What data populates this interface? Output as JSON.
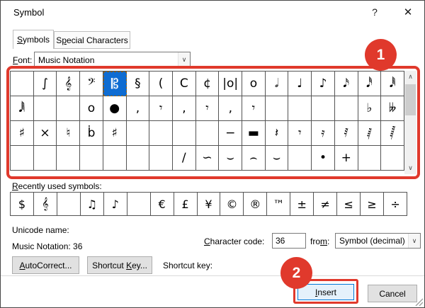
{
  "window": {
    "title": "Symbol",
    "help_glyph": "?",
    "close_glyph": "✕"
  },
  "tabs": [
    {
      "label": "Symbols",
      "active": true
    },
    {
      "label": "Special Characters",
      "active": false
    }
  ],
  "font_row": {
    "label": "Font:",
    "value": "Music Notation",
    "arrow_glyph": "∨"
  },
  "symbol_grid": {
    "columns": 17,
    "selected_row": 0,
    "selected_col": 4,
    "rows": [
      [
        "",
        "∫",
        "𝄞",
        "𝄢",
        "𝄡",
        "§",
        "(",
        "C",
        "¢",
        "|o|",
        "o",
        "𝅗𝅥",
        "♩",
        "♪",
        "𝅘𝅥𝅯",
        "𝅘𝅥𝅰",
        "𝅘𝅥𝅱"
      ],
      [
        "𝅘𝅥𝅲",
        "",
        "",
        "o",
        "●",
        "‚",
        "𝄾",
        "‚",
        "𝄾",
        "‚",
        "𝄾",
        "",
        "",
        "",
        "",
        "♭",
        "𝄫"
      ],
      [
        "♯",
        "×",
        "♮",
        "ḃ",
        "♯",
        "",
        "",
        "",
        "",
        "−",
        "▬",
        "𝄽",
        "𝄾",
        "𝄿",
        "𝅀",
        "𝅁",
        "𝅂"
      ],
      [
        "",
        "",
        "",
        "",
        "",
        "",
        "",
        "∕",
        "∽",
        "⌣",
        "⌢",
        "⌣",
        "",
        "•",
        "+",
        "",
        ""
      ]
    ],
    "scroll_up_glyph": "∧",
    "scroll_down_glyph": "∨"
  },
  "recently_used": {
    "label": "Recently used symbols:",
    "rows": [
      [
        "$",
        "𝄞",
        "",
        "♫",
        "♪",
        "",
        "€",
        "£",
        "¥",
        "©",
        "®",
        "™",
        "±",
        "≠",
        "≤",
        "≥",
        "÷"
      ]
    ]
  },
  "details": {
    "unicode_name_label": "Unicode name:",
    "unicode_name_value": "Music Notation: 36",
    "char_code_label": "Character code:",
    "char_code_value": "36",
    "from_label": "from:",
    "from_value": "Symbol (decimal)",
    "from_arrow_glyph": "∨"
  },
  "actions": {
    "autocorrect": "AutoCorrect...",
    "shortcut_key_button": "Shortcut Key...",
    "shortcut_key_label": "Shortcut key:",
    "insert": "Insert",
    "cancel": "Cancel"
  },
  "annotations": {
    "step1": "1",
    "step2": "2",
    "accent_color": "#e0392c"
  }
}
